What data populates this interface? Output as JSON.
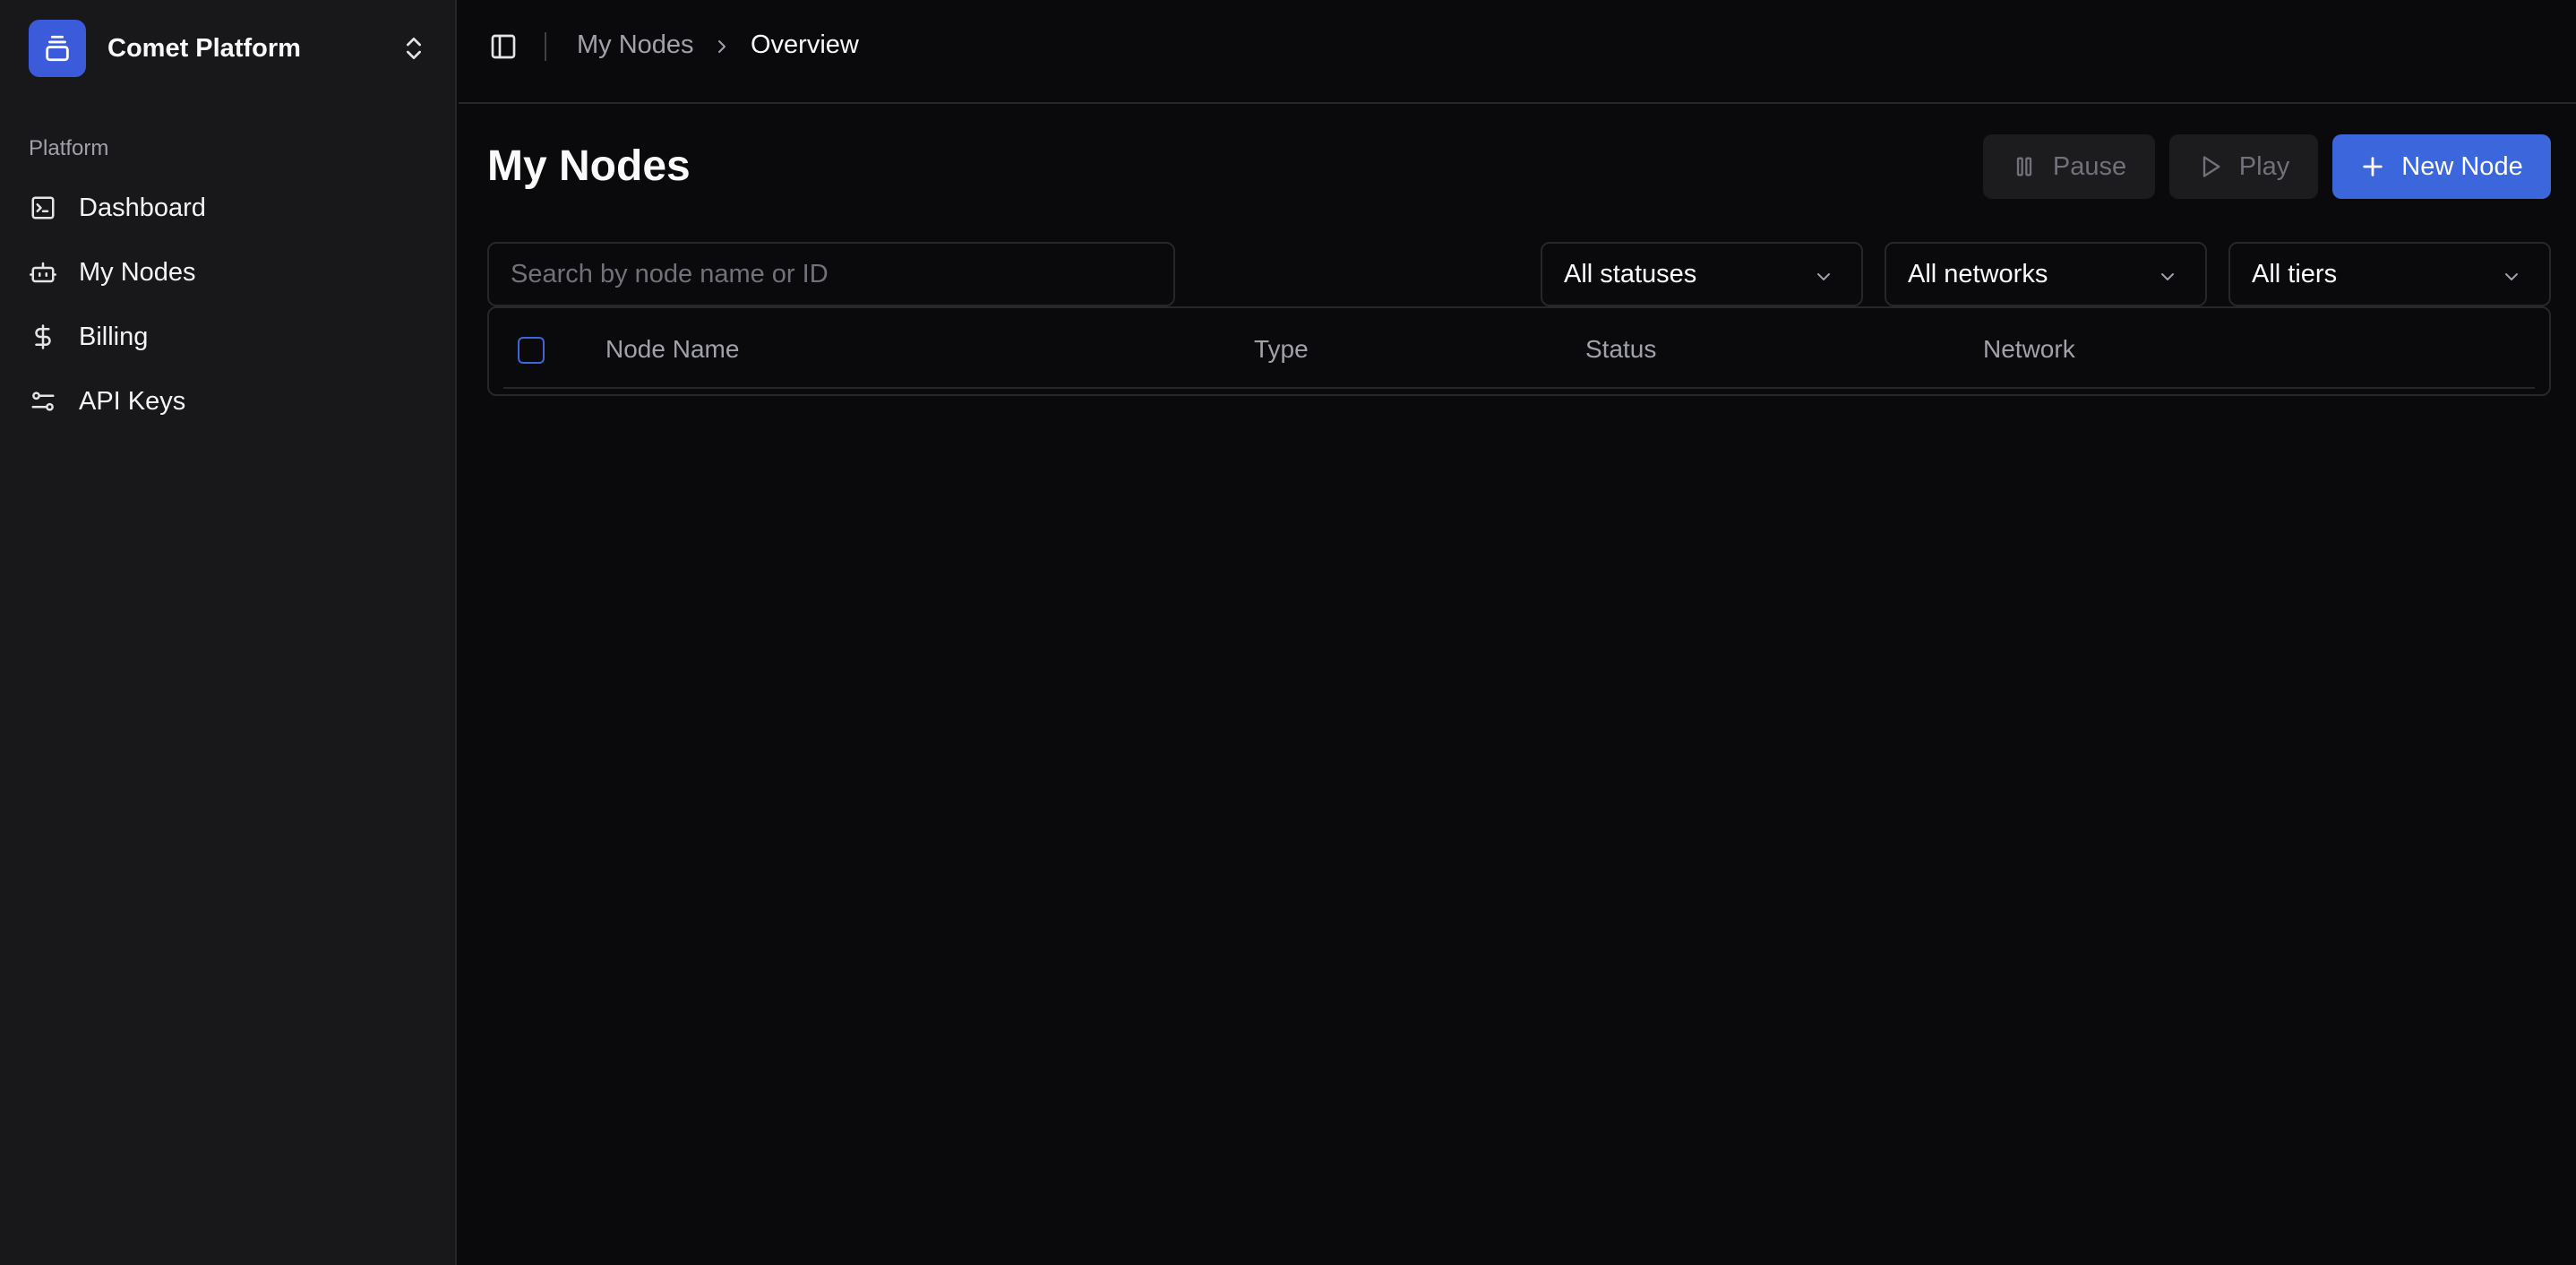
{
  "sidebar": {
    "brand": {
      "name": "Comet Platform",
      "logo_icon": "layers-icon",
      "switch_icon": "chevrons-up-down-icon"
    },
    "section_label": "Platform",
    "items": [
      {
        "label": "Dashboard",
        "icon": "terminal-icon"
      },
      {
        "label": "My Nodes",
        "icon": "bot-icon"
      },
      {
        "label": "Billing",
        "icon": "dollar-icon"
      },
      {
        "label": "API Keys",
        "icon": "sliders-icon"
      }
    ]
  },
  "header": {
    "breadcrumb": [
      "My Nodes",
      "Overview"
    ]
  },
  "main": {
    "title": "My Nodes",
    "actions": {
      "pause_label": "Pause",
      "play_label": "Play",
      "new_label": "New Node"
    },
    "search": {
      "placeholder": "Search by node name or ID",
      "value": ""
    },
    "filters": {
      "status": "All statuses",
      "network": "All networks",
      "tier": "All tiers"
    },
    "table": {
      "columns": [
        "Node Name",
        "Type",
        "Status",
        "Network"
      ],
      "rows": []
    }
  },
  "colors": {
    "accent": "#3b66dc",
    "background": "#0a0a0c",
    "sidebar": "#18181b",
    "border": "#27272a"
  }
}
